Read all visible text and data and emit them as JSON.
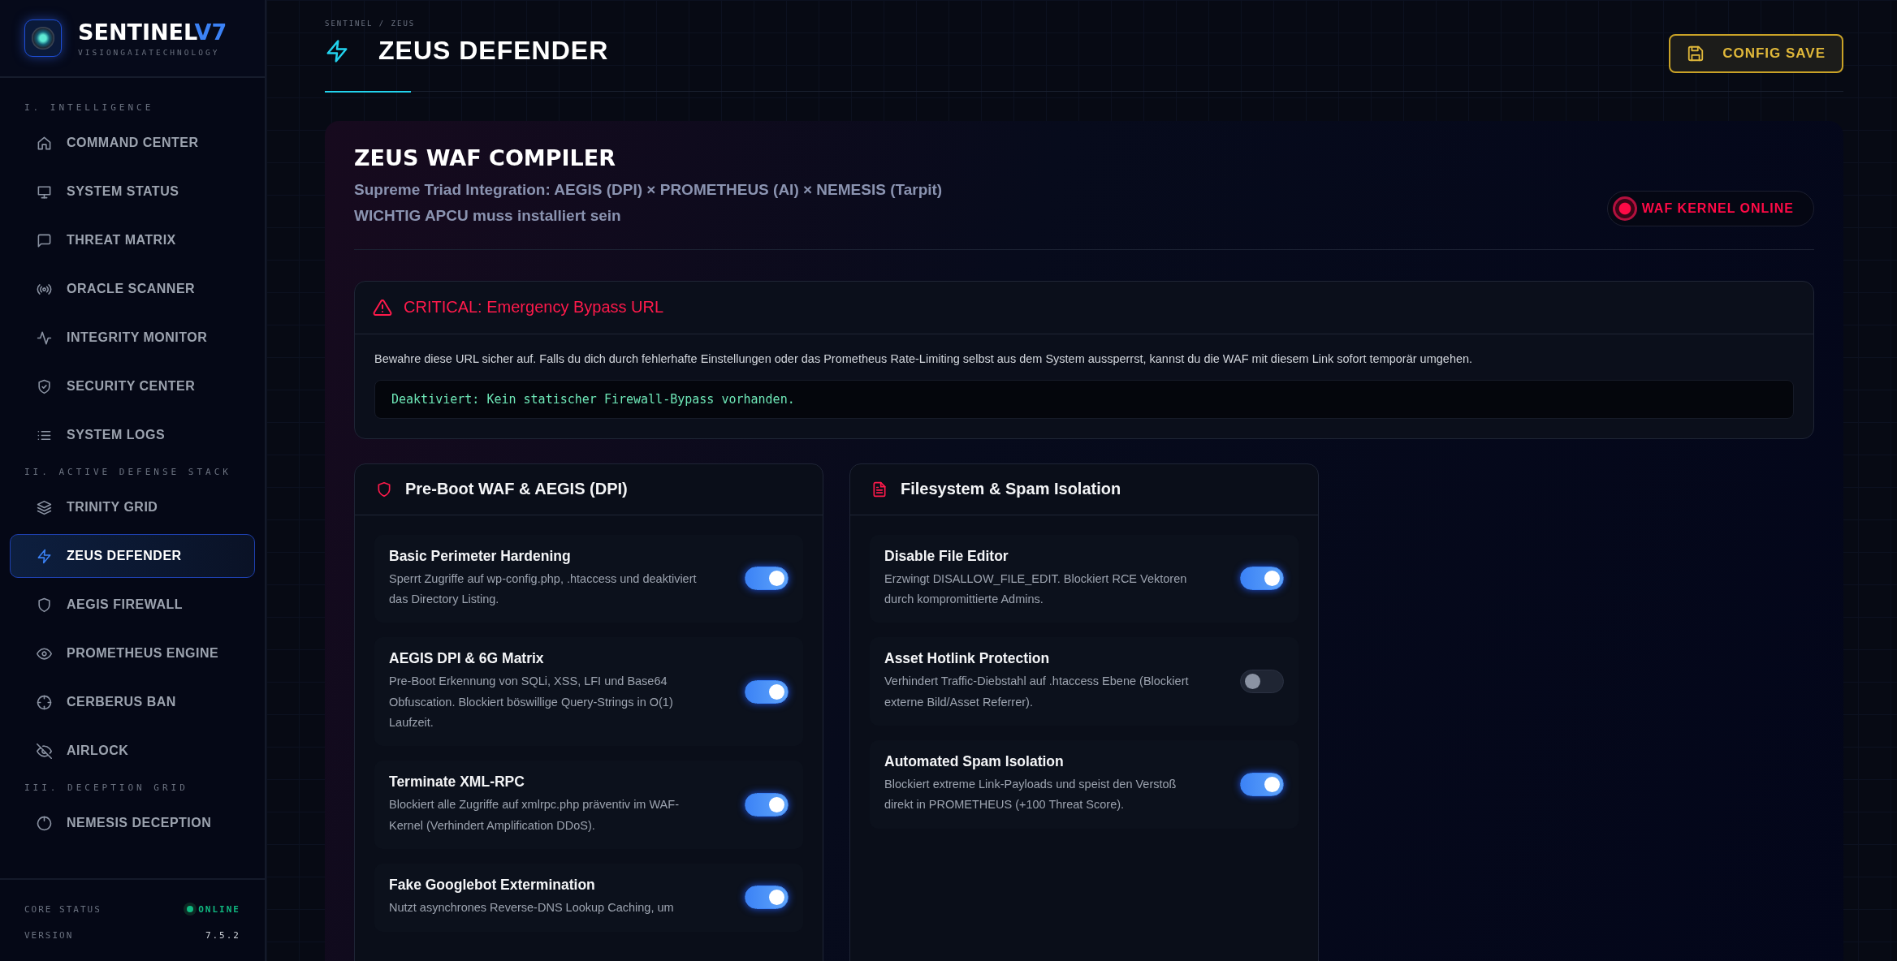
{
  "brand": {
    "name": "SENTINEL",
    "version": "V7",
    "tagline": "VISIONGAIATECHNOLOGY"
  },
  "sidebar": {
    "sections": [
      {
        "title": "I. INTELLIGENCE",
        "items": [
          {
            "label": "COMMAND CENTER",
            "kind": "home",
            "selected": false
          },
          {
            "label": "SYSTEM STATUS",
            "kind": "monitor",
            "selected": false
          },
          {
            "label": "THREAT MATRIX",
            "kind": "message",
            "selected": false
          },
          {
            "label": "ORACLE SCANNER",
            "kind": "radio",
            "selected": false
          },
          {
            "label": "INTEGRITY MONITOR",
            "kind": "activity",
            "selected": false
          },
          {
            "label": "SECURITY CENTER",
            "kind": "security",
            "selected": false
          },
          {
            "label": "SYSTEM LOGS",
            "kind": "list",
            "selected": false
          }
        ]
      },
      {
        "title": "II. ACTIVE DEFENSE STACK",
        "items": [
          {
            "label": "TRINITY GRID",
            "kind": "layers",
            "selected": false
          },
          {
            "label": "ZEUS DEFENDER",
            "kind": "zap",
            "selected": true
          },
          {
            "label": "AEGIS FIREWALL",
            "kind": "shield",
            "selected": false
          },
          {
            "label": "PROMETHEUS ENGINE",
            "kind": "eye",
            "selected": false
          },
          {
            "label": "CERBERUS BAN",
            "kind": "crosshair",
            "selected": false
          },
          {
            "label": "AIRLOCK",
            "kind": "hidden",
            "selected": false
          }
        ]
      },
      {
        "title": "III. DECEPTION GRID",
        "items": [
          {
            "label": "NEMESIS DECEPTION",
            "kind": "target",
            "selected": false
          }
        ]
      }
    ],
    "footer": [
      {
        "label": "CORE STATUS",
        "value": "ONLINE",
        "kind": "status"
      },
      {
        "label": "VERSION",
        "value": "7.5.2",
        "kind": "text"
      }
    ]
  },
  "header": {
    "breadcrumb": "SENTINEL / ZEUS",
    "title": "ZEUS DEFENDER",
    "button": "CONFIG SAVE"
  },
  "card": {
    "title": "ZEUS WAF COMPILER",
    "subtitle": "Supreme Triad Integration: AEGIS (DPI) × PROMETHEUS (AI) × NEMESIS (Tarpit)",
    "note": "WICHTIG APCU muss installiert sein",
    "badge": "WAF KERNEL ONLINE"
  },
  "alert": {
    "title": "CRITICAL: Emergency Bypass URL",
    "text": "Bewahre diese URL sicher auf. Falls du dich durch fehlerhafte Einstellungen oder das Prometheus Rate-Limiting selbst aus dem System aussperrst, kannst du die WAF mit diesem Link sofort temporär umgehen.",
    "code": "Deaktiviert: Kein statischer Firewall-Bypass vorhanden."
  },
  "panels": [
    {
      "title": "Pre-Boot WAF & AEGIS (DPI)",
      "kind": "shield",
      "toggles": [
        {
          "title": "Basic Perimeter Hardening",
          "description": "Sperrt Zugriffe auf wp-config.php, .htaccess und deaktiviert das Directory Listing.",
          "on": true
        },
        {
          "title": "AEGIS DPI & 6G Matrix",
          "description": "Pre-Boot Erkennung von SQLi, XSS, LFI und Base64 Obfuscation. Blockiert böswillige Query-Strings in O(1) Laufzeit.",
          "on": true
        },
        {
          "title": "Terminate XML-RPC",
          "description": "Blockiert alle Zugriffe auf xmlrpc.php präventiv im WAF-Kernel (Verhindert Amplification DDoS).",
          "on": true
        },
        {
          "title": "Fake Googlebot Extermination",
          "description": "Nutzt asynchrones Reverse-DNS Lookup Caching, um",
          "on": true
        }
      ]
    },
    {
      "title": "Filesystem & Spam Isolation",
      "kind": "file",
      "toggles": [
        {
          "title": "Disable File Editor",
          "description": "Erzwingt DISALLOW_FILE_EDIT. Blockiert RCE Vektoren durch kompromittierte Admins.",
          "on": true
        },
        {
          "title": "Asset Hotlink Protection",
          "description": "Verhindert Traffic-Diebstahl auf .htaccess Ebene (Blockiert externe Bild/Asset Referrer).",
          "on": false
        },
        {
          "title": "Automated Spam Isolation",
          "description": "Blockiert extreme Link-Payloads und speist den Verstoß direkt in PROMETHEUS (+100 Threat Score).",
          "on": true
        }
      ]
    }
  ]
}
